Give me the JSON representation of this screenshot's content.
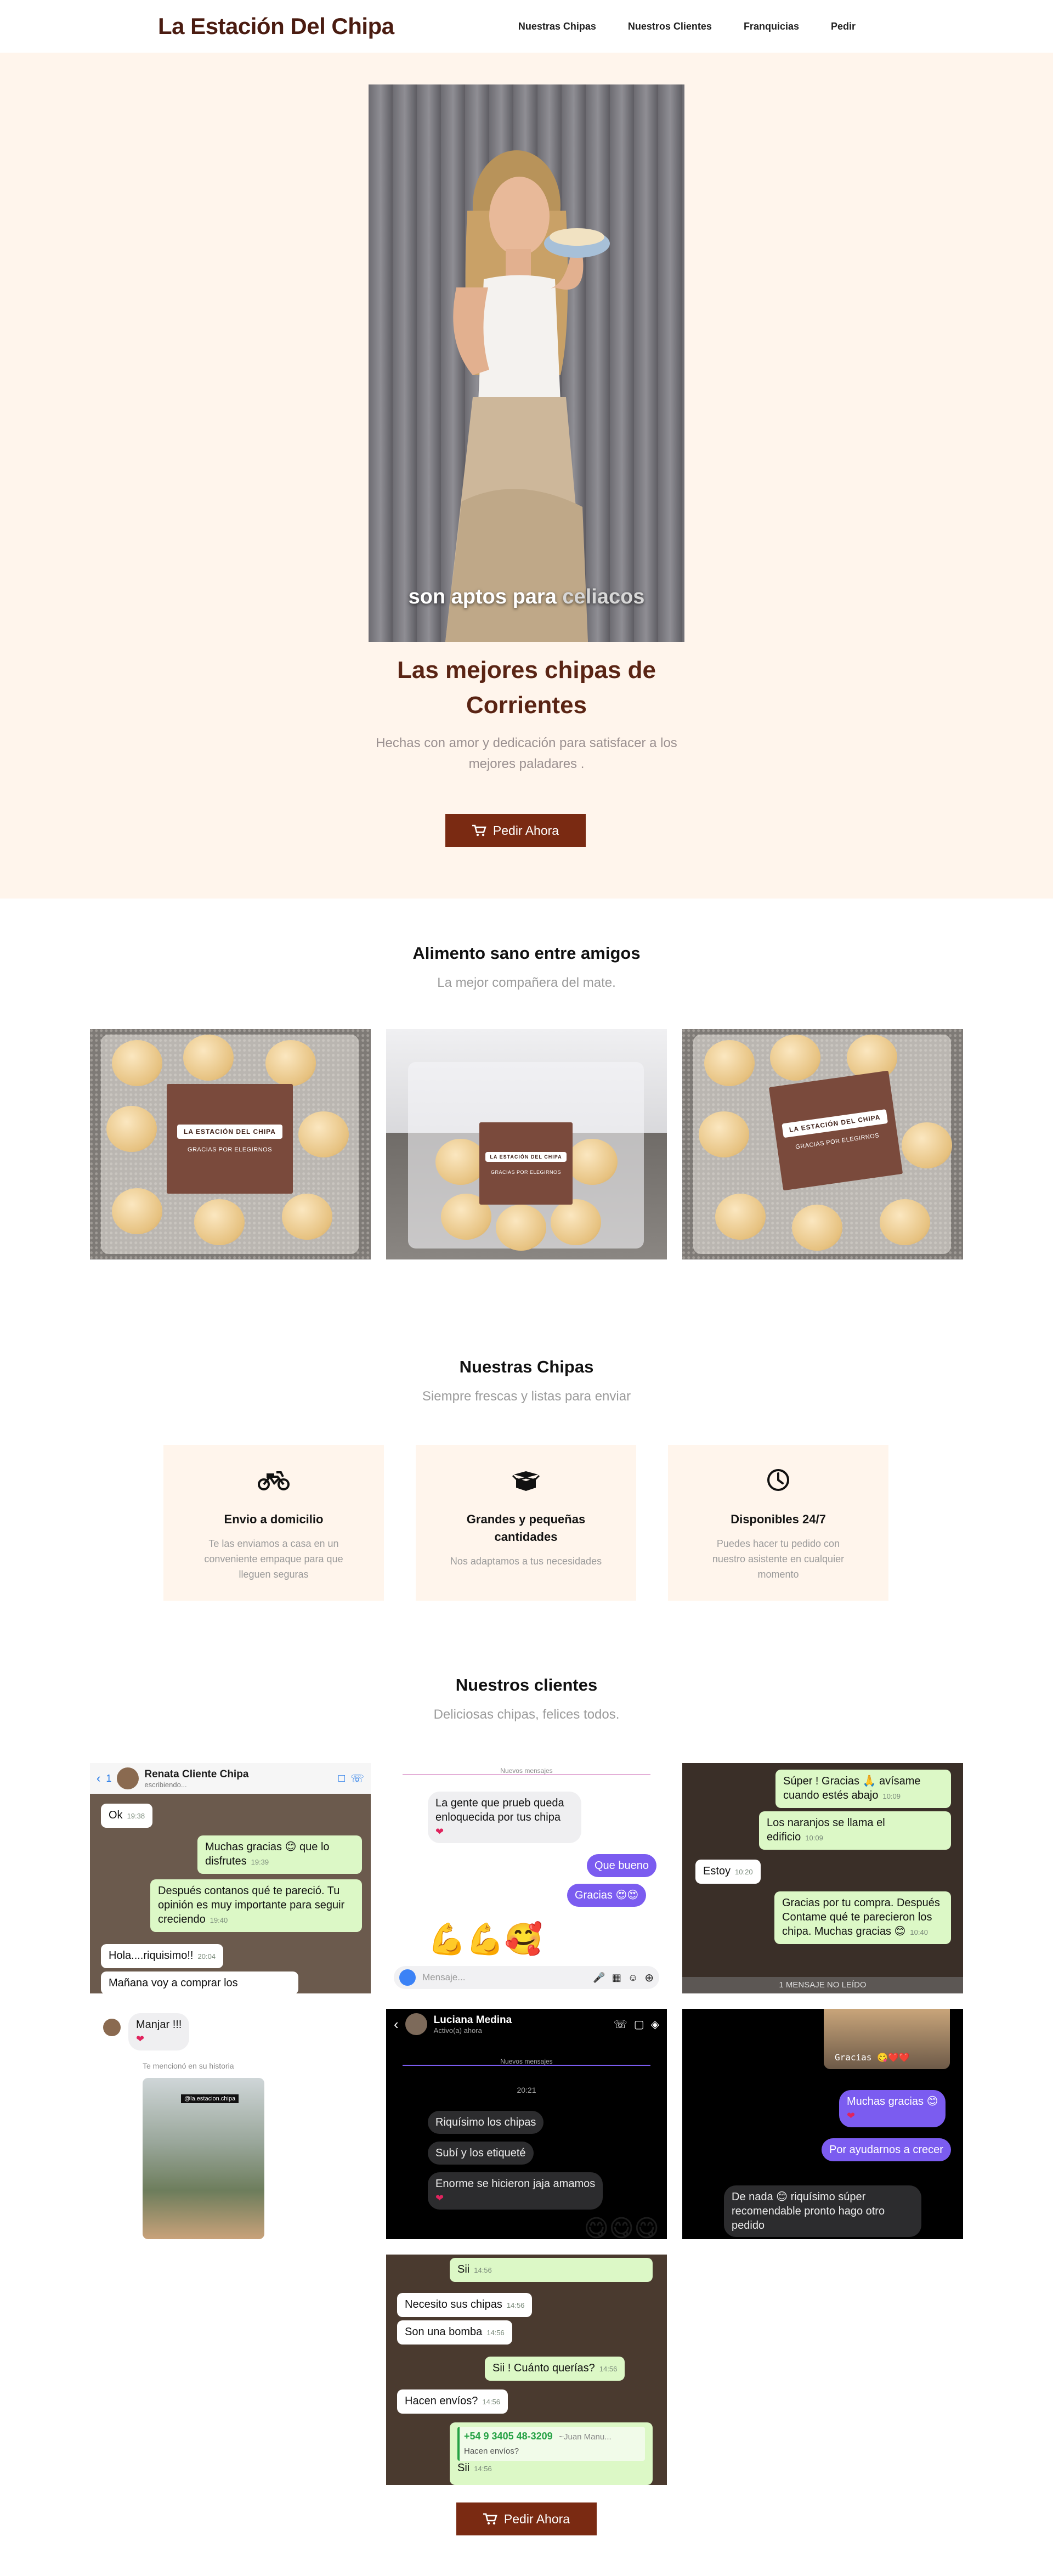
{
  "header": {
    "brand": "La Estación Del Chipa",
    "nav": [
      "Nuestras Chipas",
      "Nuestros Clientes",
      "Franquicias",
      "Pedir"
    ]
  },
  "hero": {
    "video_caption_main": "son aptos para",
    "video_caption_dim": "celiacos",
    "title_line1": "Las mejores chipas de",
    "title_line2": "Corrientes",
    "subtitle_line1": "Hechas con amor y dedicación para satisfacer a los",
    "subtitle_line2": "mejores paladares .",
    "cta": "Pedir Ahora"
  },
  "products": {
    "title": "Alimento sano entre amigos",
    "subtitle": "La mejor compañera del mate.",
    "label_brand": "LA ESTACIÓN DEL CHIPA",
    "label_thanks": "GRACIAS POR ELEGIRNOS"
  },
  "features": {
    "title": "Nuestras Chipas",
    "subtitle": "Siempre frescas y listas para enviar",
    "items": [
      {
        "icon": "motorcycle-icon",
        "title": "Envio a domicilio",
        "text": "Te las enviamos a casa en un conveniente empaque para que lleguen seguras"
      },
      {
        "icon": "box-icon",
        "title": "Grandes y pequeñas cantidades",
        "text": "Nos adaptamos a tus necesidades"
      },
      {
        "icon": "clock-icon",
        "title": "Disponibles 24/7",
        "text": "Puedes hacer tu pedido con nuestro asistente en cualquier momento"
      }
    ]
  },
  "clients": {
    "title": "Nuestros clientes",
    "subtitle": "Deliciosas chipas, felices todos.",
    "shot1": {
      "back": "1",
      "name": "Renata Cliente Chipa",
      "status": "escribiendo...",
      "msg_ok": "Ok",
      "ts_ok": "19:38",
      "msg_thanks": "Muchas gracias 😊 que lo disfrutes",
      "ts_thanks": "19:39",
      "msg_opinion": "Después contanos qué te pareció. Tu opinión es muy importante para seguir creciendo",
      "ts_opinion": "19:40",
      "msg_hola": "Hola....riquisimo!!",
      "ts_hola": "20:04",
      "msg_manana": "Mañana voy a comprar los"
    },
    "shot2": {
      "divider": "Nuevos mensajes",
      "msg1": "La gente que prueb queda enloquecida por tus chipa",
      "msg2": "Que bueno",
      "msg3": "Gracias 😍😍",
      "emoji": "💪💪🥰",
      "input_placeholder": "Mensaje..."
    },
    "shot3": {
      "msg1": "Súper ! Gracias 🙏 avísame cuando estés abajo",
      "ts1": "10:09",
      "msg2": "Los naranjos se llama el edificio",
      "ts2": "10:09",
      "msg3": "Estoy",
      "ts3": "10:20",
      "msg4": "Gracias por tu compra. Después Contame qué te parecieron los chipa. Muchas gracias 😊",
      "ts4": "10:40",
      "footer": "1 MENSAJE NO LEÍDO"
    },
    "shot4": {
      "msg1": "Manjar !!!",
      "mention": "Te mencionó en su historia",
      "story_tag": "@la.estacion.chipa"
    },
    "shot5": {
      "name": "Luciana Medina",
      "status": "Activo(a) ahora",
      "divider": "Nuevos mensajes",
      "time": "20:21",
      "msg1": "Riquísimo los chipas",
      "msg2": "Subí y los etiqueté",
      "msg3": "Enorme se hicieron jaja amamos"
    },
    "shot6": {
      "story_text": "Gracias 😋❤️❤️",
      "msg1": "Muchas gracias 😊",
      "msg2": "Por ayudarnos a crecer",
      "msg3": "De nada 😊 riquísimo súper recomendable pronto hago otro pedido"
    },
    "shot7": {
      "msg0": "Sii",
      "ts0": "14:56",
      "msg1": "Necesito sus chipas",
      "ts1": "14:56",
      "msg2": "Son una bomba",
      "ts2": "14:56",
      "msg3": "Sii ! Cuánto querías?",
      "ts3": "14:56",
      "msg4": "Hacen envíos?",
      "ts4": "14:56",
      "quote_phone": "+54 9 3405 48-3209",
      "quote_name": "~Juan Manu...",
      "quote_text": "Hacen envíos?",
      "msg5": "Sii",
      "ts5": "14:56"
    },
    "cta": "Pedir Ahora"
  },
  "colors": {
    "brand": "#4a1c11",
    "button": "#7a2a12",
    "cream": "#fff5ec"
  }
}
